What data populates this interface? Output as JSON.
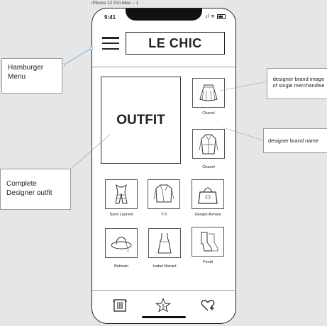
{
  "frame": {
    "label": "iPhone 12 Pro Max – 1"
  },
  "status_bar": {
    "time": "9:41"
  },
  "header": {
    "brand": "LE CHIC"
  },
  "outfit": {
    "label": "OUTFIT"
  },
  "items": [
    {
      "label": "Chanel",
      "icon": "skirt-icon"
    },
    {
      "label": "Chanel",
      "icon": "trench-coat-icon"
    },
    {
      "label": "Saint Laurent",
      "icon": "scarf-icon"
    },
    {
      "label": "Y-3",
      "icon": "jacket-icon"
    },
    {
      "label": "Giorgio Armani",
      "icon": "handbag-icon"
    },
    {
      "label": "Balmain",
      "icon": "hat-icon"
    },
    {
      "label": "Isabel Marant",
      "icon": "dress-icon"
    },
    {
      "label": "Fendi",
      "icon": "heels-icon"
    }
  ],
  "tabs": [
    {
      "icon": "wardrobe-icon"
    },
    {
      "icon": "star-dollar-icon",
      "badge": "$"
    },
    {
      "icon": "heart-plus-icon"
    }
  ],
  "annotations": {
    "hamburger": "Hamburger Menu",
    "image": "designer brand image of single merchandise",
    "brand_name": "designer brand name",
    "outfit": "Complete Designer outfit"
  }
}
